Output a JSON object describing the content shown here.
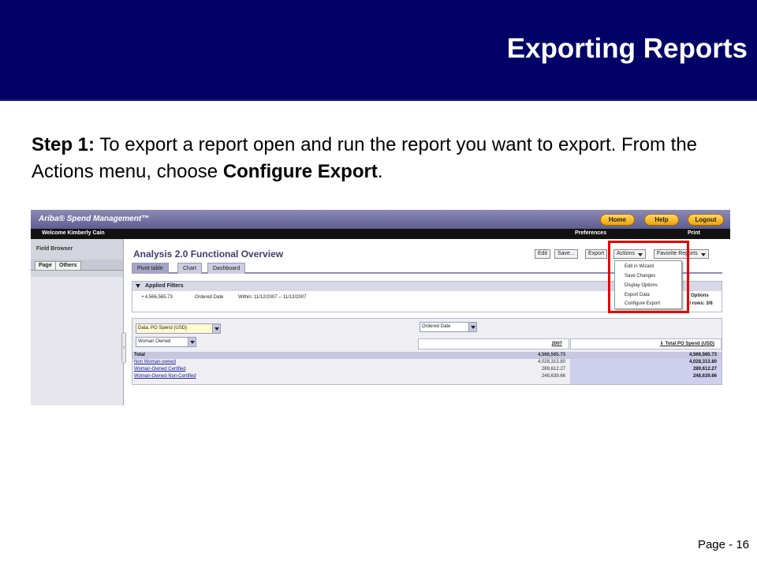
{
  "slide": {
    "title": "Exporting Reports",
    "step_label": "Step 1:",
    "instruction_text": " To export a report open and run the report you want to export. From the Actions menu, choose ",
    "instruction_bold": "Configure Export",
    "instruction_end": ".",
    "page_number": "Page - 16"
  },
  "app": {
    "logo": "Ariba® Spend Management™",
    "top_buttons": [
      "Home",
      "Help",
      "Logout"
    ],
    "welcome": "Welcome Kimberly Cain",
    "preferences": "Preferences",
    "print": "Print",
    "left_pane": {
      "title": "Field Browser",
      "tabs": [
        "Page",
        "Others"
      ]
    },
    "report_title": "Analysis 2.0 Functional Overview",
    "action_buttons": [
      "Edit",
      "Save...",
      "Export",
      "Actions",
      "Favorite Reports"
    ],
    "tabs": [
      "Pivot table",
      "Chart",
      "Dashboard"
    ],
    "filters": {
      "heading": "Applied Filters",
      "value": "• 4,566,565.73",
      "field": "Ordered Date",
      "range": "Within: 11/12/2007 -- 11/13/2007",
      "right_line1": "y Options",
      "right_line2": "al rows: 3/8"
    },
    "pivot": {
      "data_selector": "Data: PO Spend (USD)",
      "row_selector": "Woman Owned",
      "col_selector": "Ordered Date",
      "col_header": "2007",
      "total_header": "⇓ Total PO Spend (USD)",
      "rows": [
        {
          "label": "Total",
          "value": "4,566,565.73",
          "total": "4,566,565.73"
        },
        {
          "label": "Non Woman-owned",
          "value": "4,028,313.80",
          "total": "4,028,313.80"
        },
        {
          "label": "Woman-Owned Certified",
          "value": "289,612.27",
          "total": "289,612.27"
        },
        {
          "label": "Woman-Owned Non-Certified",
          "value": "248,639.66",
          "total": "248,639.66"
        }
      ]
    },
    "actions_menu": [
      "Edit in Wizard",
      "Save Changes",
      "Display Options",
      "Export Data",
      "Configure Export"
    ],
    "highlight_color": "#e60000"
  }
}
